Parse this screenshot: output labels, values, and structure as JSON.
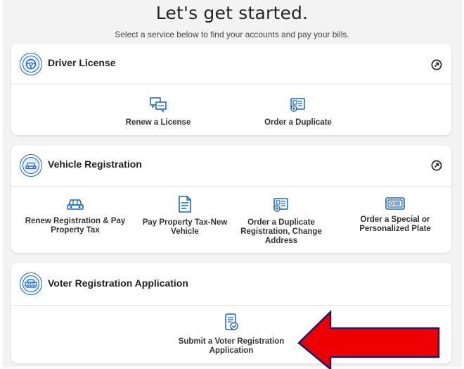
{
  "heading": "Let's get started.",
  "subheading": "Select a service below to find your accounts and pay your bills.",
  "sections": [
    {
      "title": "Driver License",
      "icon": "steering-wheel-icon",
      "services": [
        {
          "label": "Renew a License",
          "icon": "chat-bubbles-icon"
        },
        {
          "label": "Order a Duplicate",
          "icon": "id-card-add-icon"
        }
      ]
    },
    {
      "title": "Vehicle Registration",
      "icon": "car-icon",
      "services": [
        {
          "label": "Renew Registration & Pay Property Tax",
          "icon": "car-icon"
        },
        {
          "label": "Pay Property Tax-New Vehicle",
          "icon": "document-icon"
        },
        {
          "label": "Order a Duplicate Registration, Change Address",
          "icon": "id-card-add-icon"
        },
        {
          "label": "Order a Special or Personalized Plate",
          "icon": "license-plate-icon"
        }
      ]
    },
    {
      "title": "Voter Registration Application",
      "icon": "vote-icon",
      "services": [
        {
          "label": "Submit a Voter Registration Application",
          "icon": "phone-check-icon"
        }
      ]
    }
  ],
  "colors": {
    "accent": "#1565c0",
    "arrow": "#ee0000",
    "arrow_outline": "#1a1a6e"
  }
}
